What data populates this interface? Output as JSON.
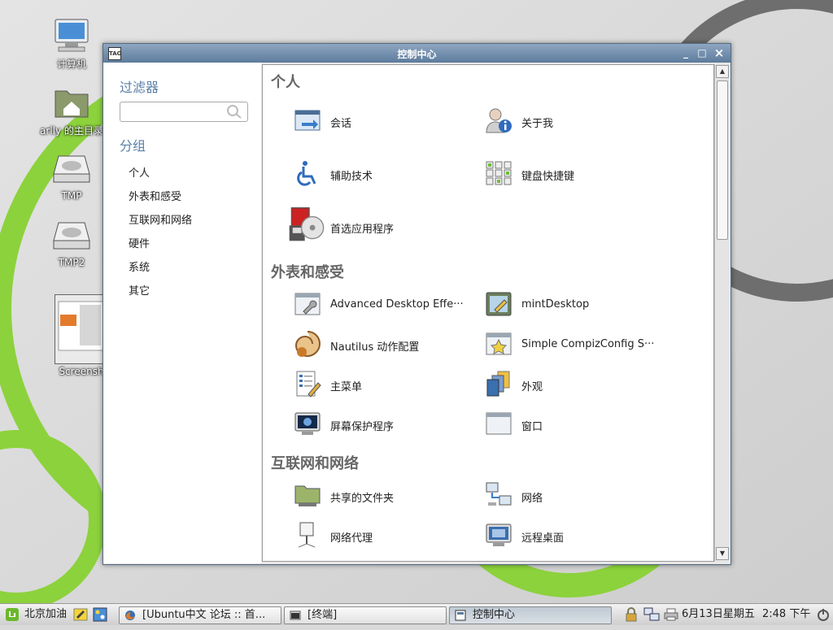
{
  "desktop": {
    "icons": [
      {
        "label": "计算机",
        "icon": "computer-icon"
      },
      {
        "label": "arlly 的主目录",
        "icon": "home-folder-icon"
      },
      {
        "label": "TMP",
        "icon": "drive-icon"
      },
      {
        "label": "TMP2",
        "icon": "drive-icon"
      },
      {
        "label": "Screensh",
        "icon": "screenshot-thumbnail"
      }
    ]
  },
  "window": {
    "title": "控制中心",
    "app_icon_text": "TAO",
    "controls": {
      "minimize": "_",
      "maximize": "□",
      "close": "×"
    }
  },
  "sidebar": {
    "filter_heading": "过滤器",
    "filter_value": "",
    "groups_heading": "分组",
    "groups": [
      "个人",
      "外表和感受",
      "互联网和网络",
      "硬件",
      "系统",
      "其它"
    ]
  },
  "sections": [
    {
      "title": "个人",
      "items": [
        {
          "label": "会话",
          "icon": "session-icon"
        },
        {
          "label": "关于我",
          "icon": "about-me-icon"
        },
        {
          "label": "辅助技术",
          "icon": "accessibility-icon"
        },
        {
          "label": "键盘快捷键",
          "icon": "keyboard-shortcuts-icon"
        },
        {
          "label": "首选应用程序",
          "icon": "preferred-apps-icon"
        }
      ]
    },
    {
      "title": "外表和感受",
      "items": [
        {
          "label": "Advanced Desktop Effe···",
          "icon": "desktop-effects-icon"
        },
        {
          "label": "mintDesktop",
          "icon": "mintdesktop-icon"
        },
        {
          "label": "Nautilus 动作配置",
          "icon": "nautilus-actions-icon"
        },
        {
          "label": "Simple CompizConfig S···",
          "icon": "compizconfig-icon"
        },
        {
          "label": "主菜单",
          "icon": "main-menu-icon"
        },
        {
          "label": "外观",
          "icon": "appearance-icon"
        },
        {
          "label": "屏幕保护程序",
          "icon": "screensaver-icon"
        },
        {
          "label": "窗口",
          "icon": "windows-icon"
        }
      ]
    },
    {
      "title": "互联网和网络",
      "items": [
        {
          "label": "共享的文件夹",
          "icon": "shared-folder-icon"
        },
        {
          "label": "网络",
          "icon": "network-icon"
        },
        {
          "label": "网络代理",
          "icon": "network-proxy-icon"
        },
        {
          "label": "远程桌面",
          "icon": "remote-desktop-icon"
        }
      ]
    }
  ],
  "taskbar": {
    "menu_label": "北京加油",
    "tasks": [
      {
        "label": "[Ubuntu中文 论坛 :: 首...",
        "icon": "firefox-icon",
        "active": false
      },
      {
        "label": "[终端]",
        "icon": "terminal-icon",
        "active": false
      },
      {
        "label": "控制中心",
        "icon": "control-center-icon",
        "active": true
      }
    ],
    "date": "6月13日星期五",
    "time": "2:48 下午"
  },
  "colors": {
    "titlebar": "#6f8daf",
    "heading": "#5a7fa6",
    "wallpaper_green": "#8cd23c"
  }
}
